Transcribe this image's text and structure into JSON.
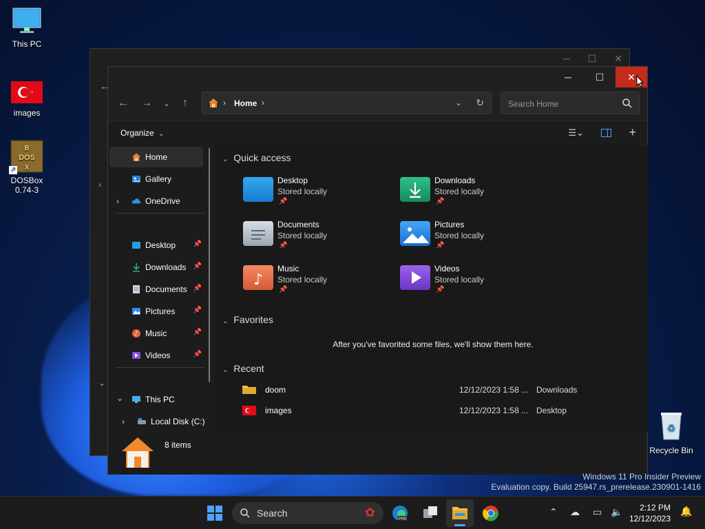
{
  "desktop": {
    "icons": [
      {
        "label": "This PC"
      },
      {
        "label": "images"
      },
      {
        "label": "DOSBox 0.74-3"
      },
      {
        "label": "Recycle Bin"
      }
    ],
    "watermark_line1": "Windows 11 Pro Insider Preview",
    "watermark_line2": "Evaluation copy. Build 25947.rs_prerelease.230901-1416"
  },
  "window": {
    "address": {
      "home_label": "Home",
      "sep": "›"
    },
    "search_placeholder": "Search Home",
    "toolbar": {
      "organize_label": "Organize"
    },
    "sidebar": {
      "items": [
        {
          "label": "Home"
        },
        {
          "label": "Gallery"
        },
        {
          "label": "OneDrive"
        },
        {
          "label": "Desktop"
        },
        {
          "label": "Downloads"
        },
        {
          "label": "Documents"
        },
        {
          "label": "Pictures"
        },
        {
          "label": "Music"
        },
        {
          "label": "Videos"
        },
        {
          "label": "This PC"
        },
        {
          "label": "Local Disk (C:)"
        }
      ]
    },
    "quick_access": {
      "heading": "Quick access",
      "items": [
        {
          "name": "Desktop",
          "status": "Stored locally"
        },
        {
          "name": "Downloads",
          "status": "Stored locally"
        },
        {
          "name": "Documents",
          "status": "Stored locally"
        },
        {
          "name": "Pictures",
          "status": "Stored locally"
        },
        {
          "name": "Music",
          "status": "Stored locally"
        },
        {
          "name": "Videos",
          "status": "Stored locally"
        }
      ]
    },
    "favorites": {
      "heading": "Favorites",
      "empty_text": "After you've favorited some files, we'll show them here."
    },
    "recent": {
      "heading": "Recent",
      "rows": [
        {
          "name": "doom",
          "date": "12/12/2023 1:58 ...",
          "location": "Downloads"
        },
        {
          "name": "images",
          "date": "12/12/2023 1:58 ...",
          "location": "Desktop"
        }
      ]
    },
    "status": {
      "count": "8 items"
    }
  },
  "taskbar": {
    "search_label": "Search",
    "time": "2:12 PM",
    "date": "12/12/2023"
  },
  "colors": {
    "close_red": "#c42b1c",
    "accent_blue": "#4ea2ff"
  }
}
